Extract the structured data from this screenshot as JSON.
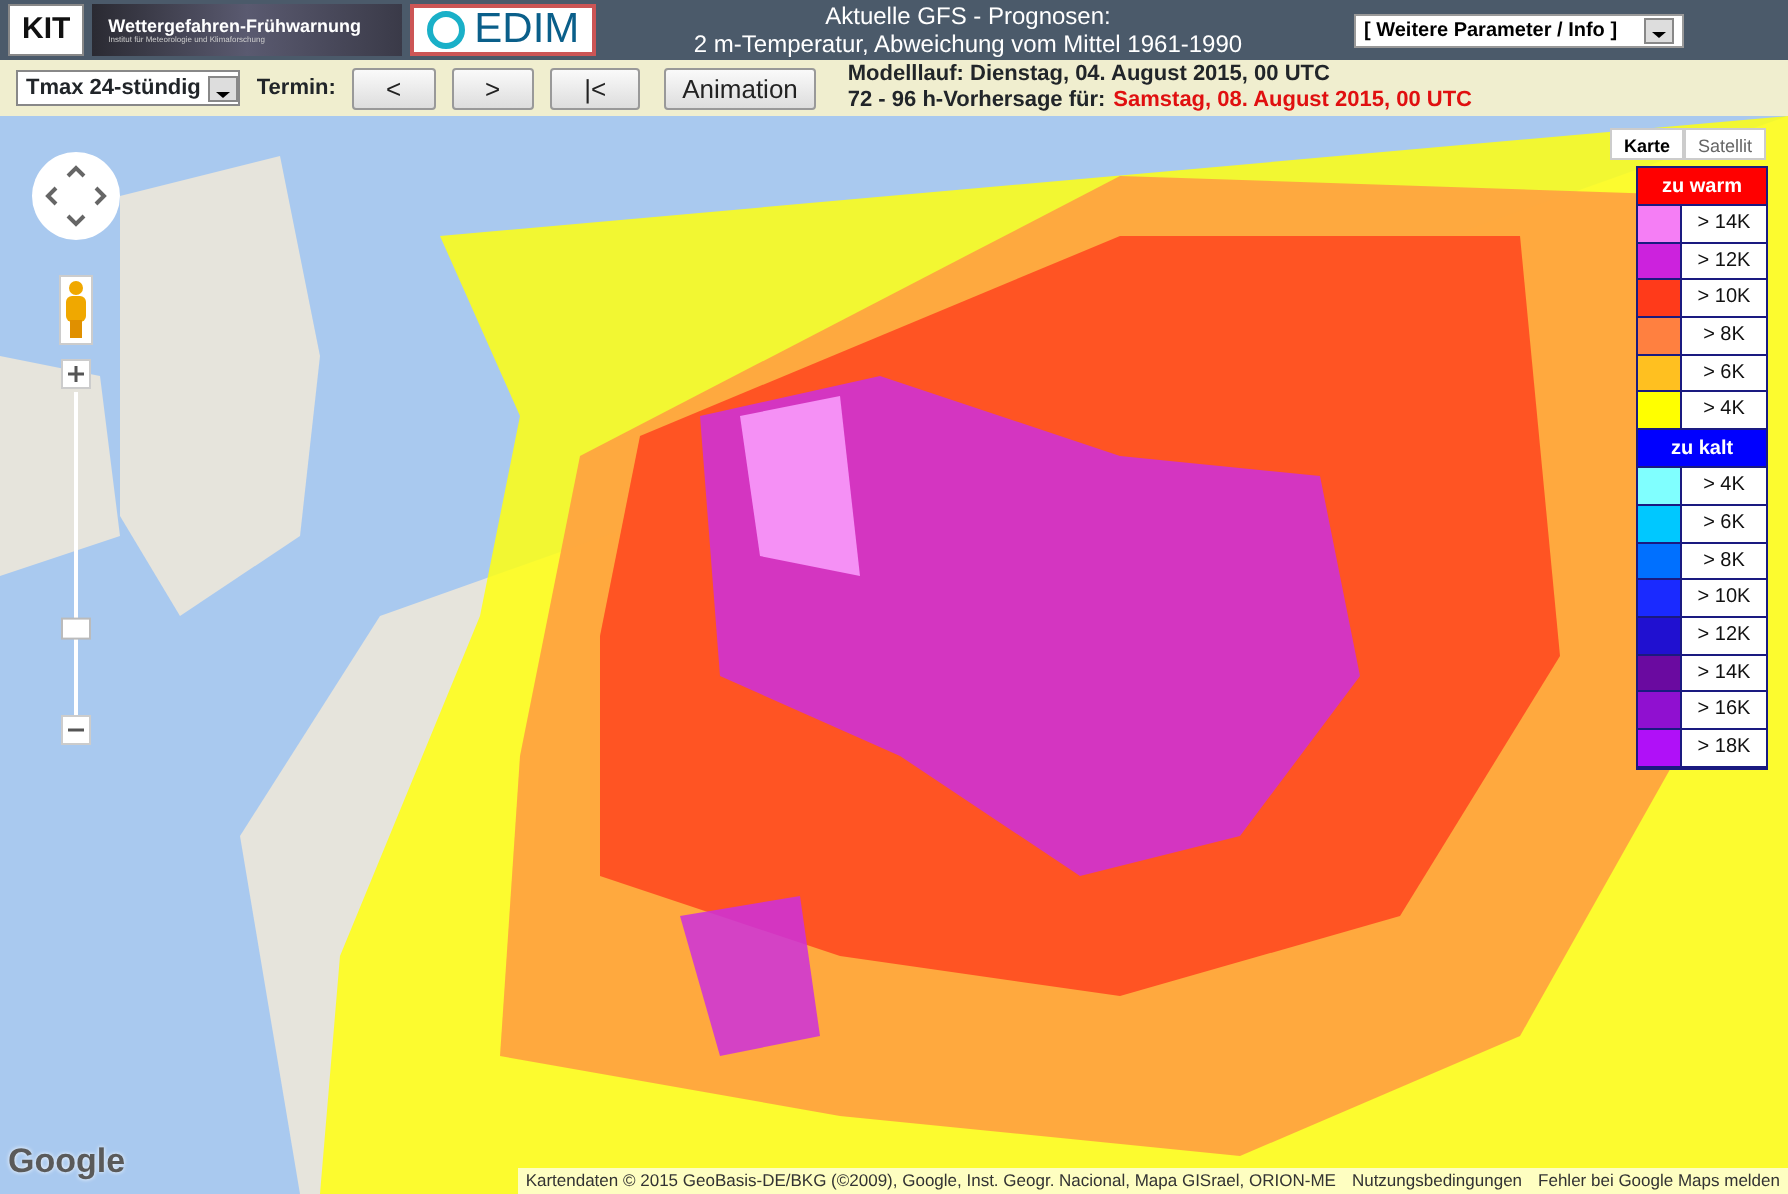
{
  "header": {
    "kit_logo": "KIT",
    "banner_title": "Wettergefahren-Frühwarnung",
    "banner_subtitle": "Institut für Meteorologie und Klimaforschung",
    "cedim_logo": "EDIM",
    "title_lines": [
      "Aktuelle GFS - Prognosen:",
      "2 m-Temperatur, Abweichung vom Mittel 1961-1990"
    ],
    "info_select": "[ Weitere Parameter / Info ]"
  },
  "toolbar": {
    "parameter_select": "Tmax 24-stündig",
    "termin_label": "Termin:",
    "buttons": [
      "<",
      ">",
      "|<",
      "Animation"
    ],
    "model_run": "Modelllauf: Dienstag, 04. August 2015, 00 UTC",
    "forecast_label": "72 - 96 h-Vorhersage für:",
    "forecast_date": "Samstag, 08. August 2015, 00 UTC"
  },
  "map": {
    "type_tabs": [
      {
        "label": "Karte",
        "selected": true
      },
      {
        "label": "Satellit",
        "selected": false
      }
    ],
    "zoom": {
      "level": 0.27
    },
    "legend": [
      {
        "title": "zu warm",
        "color": "#ff0000",
        "items": [
          {
            "label": "> 14K",
            "color": "#f57ef5"
          },
          {
            "label": "> 12K",
            "color": "#cc22dd"
          },
          {
            "label": "> 10K",
            "color": "#ff3a1a"
          },
          {
            "label": "> 8K",
            "color": "#ff8040"
          },
          {
            "label": "> 6K",
            "color": "#ffc020"
          },
          {
            "label": "> 4K",
            "color": "#ffff00"
          }
        ]
      },
      {
        "title": "zu kalt",
        "color": "#0000ff",
        "items": [
          {
            "label": "> 4K",
            "color": "#80ffff"
          },
          {
            "label": "> 6K",
            "color": "#00c8ff"
          },
          {
            "label": "> 8K",
            "color": "#0070ff"
          },
          {
            "label": "> 10K",
            "color": "#1a2aff"
          },
          {
            "label": "> 12K",
            "color": "#2010d0"
          },
          {
            "label": "> 14K",
            "color": "#6a0aa0"
          },
          {
            "label": "> 16K",
            "color": "#9010d0"
          },
          {
            "label": "> 18K",
            "color": "#b010f8"
          }
        ]
      }
    ],
    "google_logo": "Google",
    "attribution": "Kartendaten © 2015 GeoBasis-DE/BKG (©2009), Google, Inst. Geogr. Nacional, Mapa GISrael, ORION-ME",
    "links": [
      "Nutzungsbedingungen",
      "Fehler bei Google Maps melden"
    ]
  }
}
